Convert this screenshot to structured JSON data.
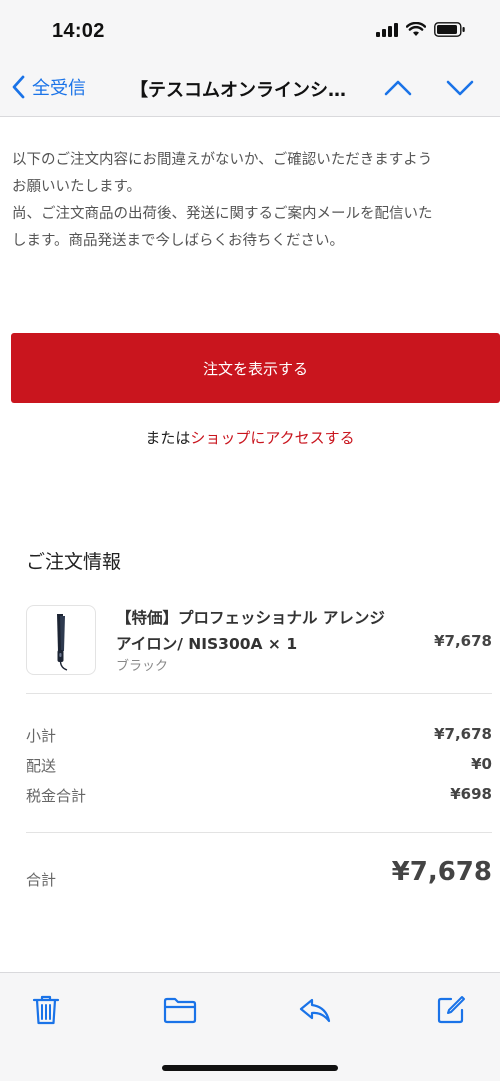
{
  "status_bar": {
    "time": "14:02"
  },
  "nav": {
    "back_label": "全受信",
    "title": "【テスコムオンラインシ…"
  },
  "intro": {
    "lines": [
      "以下のご注文内容にお間違えがないか、ご確認いただきますよう",
      "お願いいたします。",
      "尚、ご注文商品の出荷後、発送に関するご案内メールを配信いた",
      "します。商品発送まで今しばらくお待ちください。"
    ]
  },
  "actions": {
    "view_order_label": "注文を表示する",
    "or_text": "または",
    "shop_link_label": "ショップにアクセスする"
  },
  "order": {
    "section_title": "ご注文情報",
    "item": {
      "name_line1": "【特価】プロフェッショナル アレンジ",
      "name_line2": "アイロン/ NIS300A × 1",
      "variant": "ブラック",
      "price": "¥7,678"
    },
    "summary": [
      {
        "label": "小計",
        "value": "¥7,678"
      },
      {
        "label": "配送",
        "value": "¥0"
      },
      {
        "label": "税金合計",
        "value": "¥698"
      }
    ],
    "total": {
      "label": "合計",
      "value": "¥7,678"
    }
  },
  "colors": {
    "accent_blue": "#1a73e8",
    "brand_red": "#c9151e"
  },
  "icons": {
    "back": "chevron-left-icon",
    "up": "chevron-up-icon",
    "down": "chevron-down-icon",
    "trash": "trash-icon",
    "folder": "folder-icon",
    "reply": "reply-icon",
    "compose": "compose-icon"
  }
}
